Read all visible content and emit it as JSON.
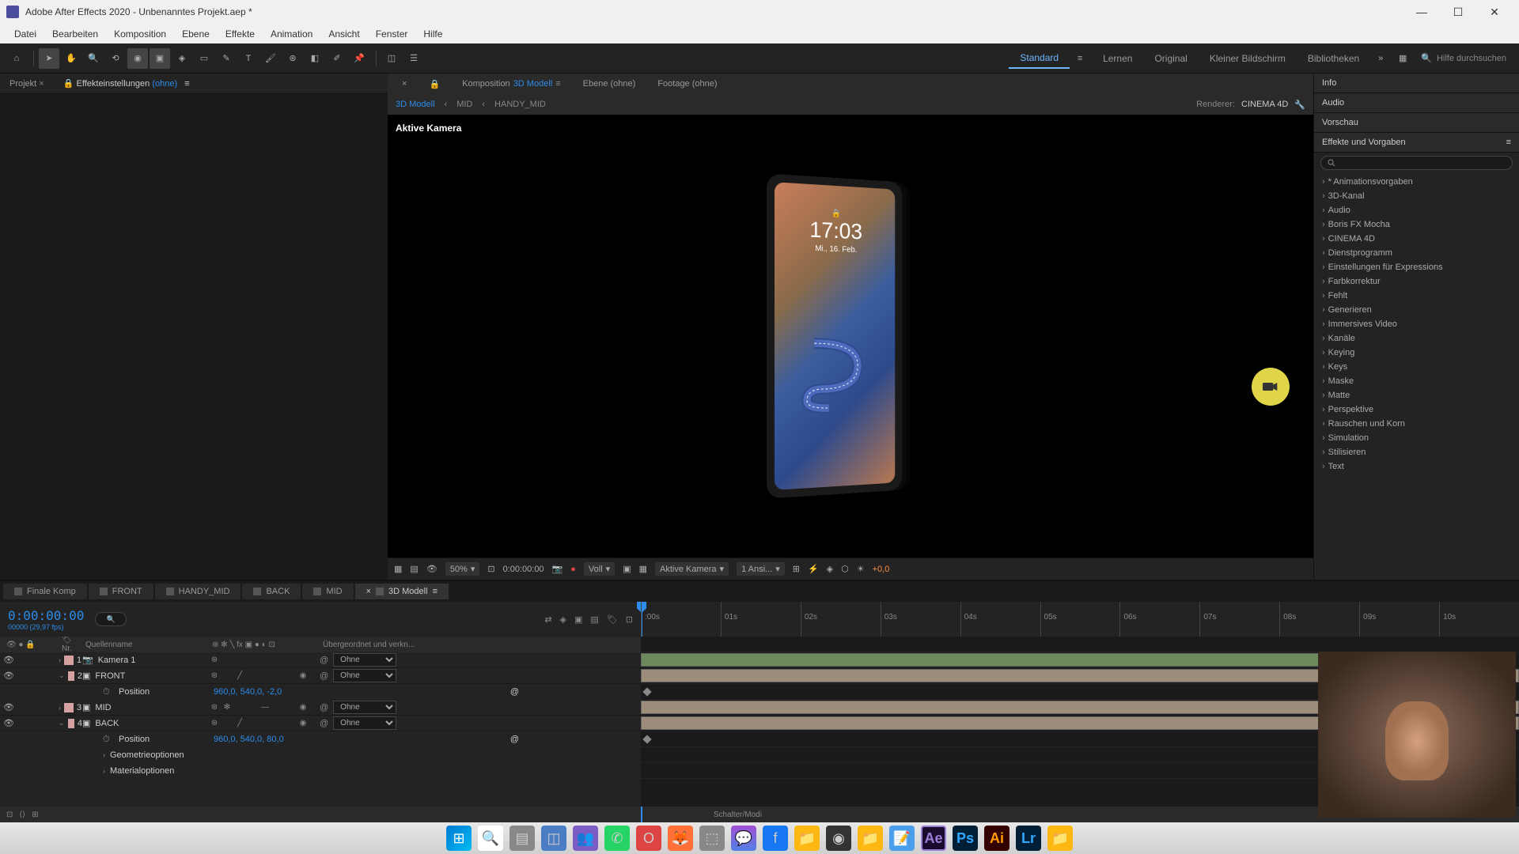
{
  "titlebar": {
    "title": "Adobe After Effects 2020 - Unbenanntes Projekt.aep *"
  },
  "menubar": [
    "Datei",
    "Bearbeiten",
    "Komposition",
    "Ebene",
    "Effekte",
    "Animation",
    "Ansicht",
    "Fenster",
    "Hilfe"
  ],
  "workspaces": {
    "active": "Standard",
    "items": [
      "Standard",
      "Lernen",
      "Original",
      "Kleiner Bildschirm",
      "Bibliotheken"
    ]
  },
  "search_help": {
    "placeholder": "Hilfe durchsuchen"
  },
  "left_panels": {
    "project": "Projekt",
    "effect_controls": "Effekteinstellungen",
    "effect_controls_suffix": "(ohne)"
  },
  "comp_tabs": {
    "composition": "Komposition",
    "composition_name": "3D Modell",
    "layer": "Ebene  (ohne)",
    "footage": "Footage  (ohne)"
  },
  "crumbs": {
    "a": "3D Modell",
    "b": "MID",
    "c": "HANDY_MID"
  },
  "renderer": {
    "label": "Renderer:",
    "value": "CINEMA 4D"
  },
  "viewport": {
    "active_cam": "Aktive Kamera",
    "phone_time": "17:03",
    "phone_date": "Mi., 16. Feb.",
    "zoom": "50%",
    "timecode": "0:00:00:00",
    "resolution": "Voll",
    "camera": "Aktive Kamera",
    "views": "1 Ansi...",
    "offset": "+0,0"
  },
  "right_panels": {
    "info": "Info",
    "audio": "Audio",
    "preview": "Vorschau",
    "effects": "Effekte und Vorgaben",
    "effects_list": [
      "* Animationsvorgaben",
      "3D-Kanal",
      "Audio",
      "Boris FX Mocha",
      "CINEMA 4D",
      "Dienstprogramm",
      "Einstellungen für Expressions",
      "Farbkorrektur",
      "Fehlt",
      "Generieren",
      "Immersives Video",
      "Kanäle",
      "Keying",
      "Keys",
      "Maske",
      "Matte",
      "Perspektive",
      "Rauschen und Korn",
      "Simulation",
      "Stilisieren",
      "Text"
    ]
  },
  "timeline": {
    "tabs": [
      "Finale Komp",
      "FRONT",
      "HANDY_MID",
      "BACK",
      "MID",
      "3D Modell"
    ],
    "active_tab": 5,
    "timecode": "0:00:00:00",
    "fps_info": "00000 (29,97 fps)",
    "ruler": [
      ":00s",
      "01s",
      "02s",
      "03s",
      "04s",
      "05s",
      "06s",
      "07s",
      "08s",
      "09s",
      "10s"
    ],
    "headers": {
      "num": "Nr.",
      "name": "Quellenname",
      "parent": "Übergeordnet und verkn..."
    },
    "layers": [
      {
        "num": "1",
        "name": "Kamera 1",
        "color": "#d4a0a0",
        "parent": "Ohne",
        "type": "camera"
      },
      {
        "num": "2",
        "name": "FRONT",
        "color": "#d4a0a0",
        "parent": "Ohne",
        "type": "comp"
      },
      {
        "num": "3",
        "name": "MID",
        "color": "#d4a0a0",
        "parent": "Ohne",
        "type": "comp"
      },
      {
        "num": "4",
        "name": "BACK",
        "color": "#d4a0a0",
        "parent": "Ohne",
        "type": "comp"
      }
    ],
    "position_label": "Position",
    "position_front": "960,0, 540,0, -2,0",
    "position_back": "960,0, 540,0, 80,0",
    "geo_options": "Geometrieoptionen",
    "mat_options": "Materialoptionen",
    "footer": "Schalter/Modi"
  },
  "taskbar": {
    "apps": [
      "windows",
      "search",
      "taskview",
      "widgets",
      "teams",
      "whatsapp",
      "opera",
      "firefox",
      "app1",
      "messenger",
      "facebook",
      "files",
      "obs",
      "explorer",
      "notepad",
      "ae",
      "ps",
      "ai",
      "lr",
      "app2"
    ]
  }
}
